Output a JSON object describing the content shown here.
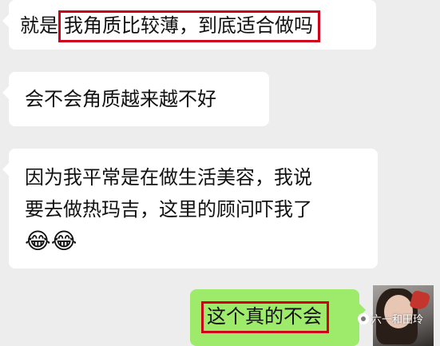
{
  "messages": [
    {
      "side": "left",
      "prefix": "就是",
      "highlight": "我角质比较薄，到底适合做吗"
    },
    {
      "side": "left",
      "text": "会不会角质越来越不好"
    },
    {
      "side": "left",
      "line1": "因为我平常是在做生活美容，我说",
      "line2": "要去做热玛吉，这里的顾问吓我了",
      "emoji": "😂😂"
    },
    {
      "side": "right",
      "highlight": "这个真的不会"
    }
  ],
  "watermark": {
    "text": "六一和田玲"
  },
  "colors": {
    "background": "#ededed",
    "incoming_bubble": "#ffffff",
    "outgoing_bubble": "#9eea6a",
    "highlight_border": "#d0021b"
  },
  "icons": {
    "avatar": "user-avatar-photo",
    "watermark_logo": "wechat-account-icon"
  }
}
